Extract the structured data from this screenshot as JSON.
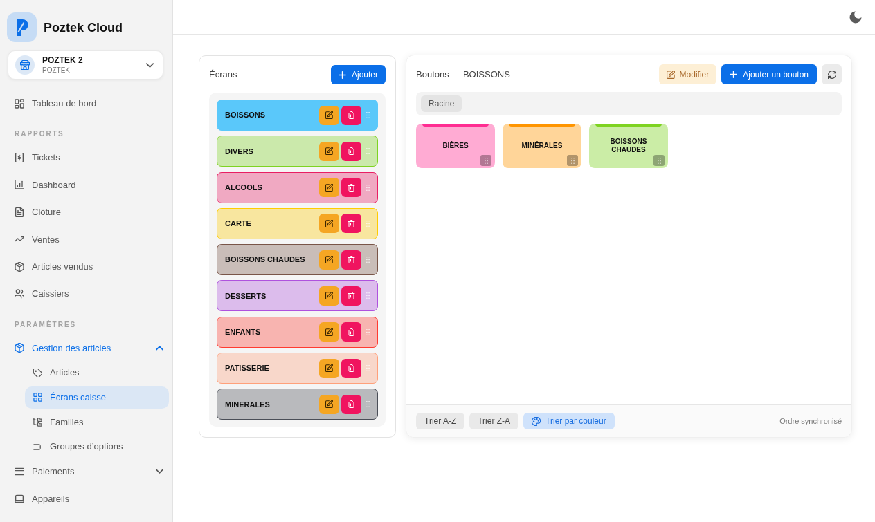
{
  "sidebar": {
    "brand": "Poztek Cloud",
    "store": {
      "name": "POZTEK 2",
      "subtitle": "POZTEK"
    },
    "sections": [
      {
        "items": [
          {
            "label": "Tableau de bord",
            "selected": false
          }
        ]
      },
      {
        "title": "RAPPORTS",
        "items": [
          {
            "label": "Tickets",
            "selected": false
          },
          {
            "label": "Dashboard",
            "selected": false
          },
          {
            "label": "Clôture",
            "selected": false
          },
          {
            "label": "Ventes",
            "selected": false
          },
          {
            "label": "Articles vendus",
            "selected": false
          },
          {
            "label": "Caissiers",
            "selected": false
          }
        ]
      },
      {
        "title": "PARAMÈTRES",
        "items": [
          {
            "label": "Gestion des articles",
            "selected": true,
            "expanded": true,
            "children": [
              {
                "label": "Articles",
                "selected": false
              },
              {
                "label": "Écrans caisse",
                "selected": true
              },
              {
                "label": "Familles",
                "selected": false
              },
              {
                "label": "Groupes d’options",
                "selected": false
              }
            ]
          },
          {
            "label": "Paiements",
            "selected": false,
            "expanded": false
          },
          {
            "label": "Appareils",
            "selected": false
          }
        ]
      }
    ]
  },
  "screens_panel": {
    "title": "Écrans",
    "add_button": "Ajouter",
    "screens": [
      {
        "name": "BOISSONS",
        "color": "#5ac8fa",
        "selected": true
      },
      {
        "name": "DIVERS",
        "color": "#7ed321",
        "selected": false
      },
      {
        "name": "ALCOOLS",
        "color": "#e91e63",
        "selected": false
      },
      {
        "name": "CARTE",
        "color": "#ffcc00",
        "selected": false
      },
      {
        "name": "BOISSONS CHAUDES",
        "color": "#795548",
        "selected": false
      },
      {
        "name": "DESSERTS",
        "color": "#af52de",
        "selected": false
      },
      {
        "name": "ENFANTS",
        "color": "#ff3b30",
        "selected": false
      },
      {
        "name": "PATISSERIE",
        "color": "#ffa07a",
        "selected": false
      },
      {
        "name": "MINERALES",
        "color": "#4a4e57",
        "selected": false
      }
    ]
  },
  "buttons_panel": {
    "title": "Boutons — BOISSONS",
    "edit_button": "Modifier",
    "add_button": "Ajouter un bouton",
    "breadcrumb": [
      "Racine"
    ],
    "tiles": [
      {
        "label": "BIÈRES",
        "color": "#ff2d92"
      },
      {
        "label": "MINÉRALES",
        "color": "#ff9500"
      },
      {
        "label": "BOISSONS CHAUDES",
        "color": "#7ed321"
      }
    ],
    "sort_buttons": [
      {
        "label": "Trier A-Z",
        "kind": "text",
        "selected": false
      },
      {
        "label": "Trier Z-A",
        "kind": "text",
        "selected": false
      },
      {
        "label": "Trier par couleur",
        "kind": "color",
        "selected": true
      }
    ],
    "sync_status": "Ordre synchronisé"
  }
}
